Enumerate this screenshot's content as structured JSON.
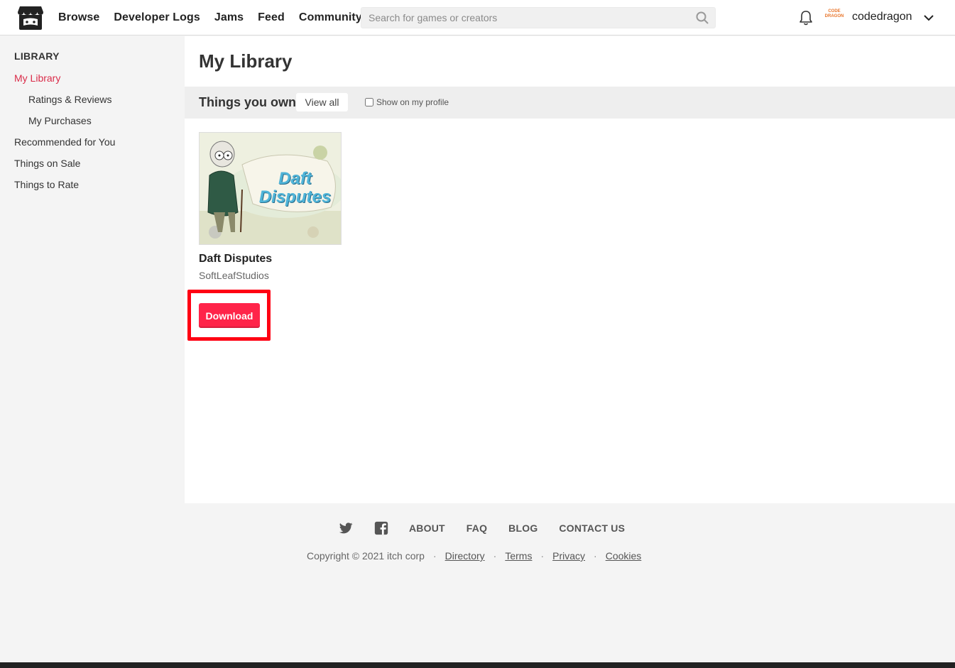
{
  "header": {
    "nav": [
      "Browse",
      "Developer Logs",
      "Jams",
      "Feed",
      "Community"
    ],
    "search_placeholder": "Search for games or creators",
    "username": "codedragon",
    "avatar_text_1": "CODE",
    "avatar_text_2": "DRAGON"
  },
  "sidebar": {
    "title": "LIBRARY",
    "items": [
      "My Library",
      "Ratings & Reviews",
      "My Purchases",
      "Recommended for You",
      "Things on Sale",
      "Things to Rate"
    ]
  },
  "main": {
    "page_title": "My Library",
    "section_title": "Things you own",
    "view_all": "View all",
    "show_on_profile": "Show on my profile",
    "game": {
      "thumb_text": "Daft Disputes",
      "title": "Daft Disputes",
      "author": "SoftLeafStudios",
      "download": "Download"
    }
  },
  "footer": {
    "links": [
      "ABOUT",
      "FAQ",
      "BLOG",
      "CONTACT US"
    ],
    "copyright": "Copyright © 2021 itch corp",
    "bottom_links": [
      "Directory",
      "Terms",
      "Privacy",
      "Cookies"
    ]
  },
  "colors": {
    "accent": "#da2c49",
    "download_button": "#ff2449",
    "highlight": "#ff0013"
  }
}
